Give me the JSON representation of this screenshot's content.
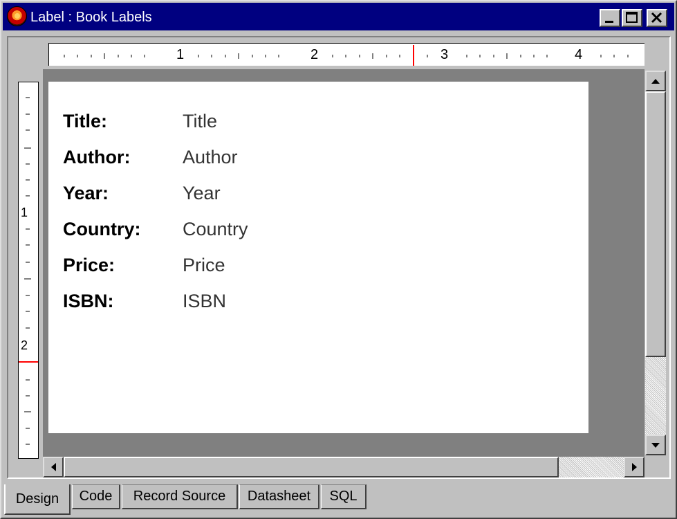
{
  "window": {
    "title": "Label : Book Labels",
    "controls": [
      "minimize-icon",
      "maximize-icon",
      "close-icon"
    ]
  },
  "ruler": {
    "horizontal_marks": [
      "1",
      "2",
      "3",
      "4"
    ],
    "vertical_marks": [
      "1",
      "2"
    ]
  },
  "label": {
    "fields": [
      {
        "label": "Title:",
        "value": "Title"
      },
      {
        "label": "Author:",
        "value": "Author"
      },
      {
        "label": "Year:",
        "value": "Year"
      },
      {
        "label": "Country:",
        "value": "Country"
      },
      {
        "label": "Price:",
        "value": "Price"
      },
      {
        "label": "ISBN:",
        "value": "ISBN"
      }
    ]
  },
  "tabs": [
    {
      "label": "Design",
      "active": true
    },
    {
      "label": "Code",
      "active": false
    },
    {
      "label": "Record Source",
      "active": false
    },
    {
      "label": "Datasheet",
      "active": false
    },
    {
      "label": "SQL",
      "active": false
    }
  ],
  "colors": {
    "titlebar": "#000080",
    "ruler_marker": "#ff0000",
    "workspace": "#808080",
    "face": "#c0c0c0"
  }
}
